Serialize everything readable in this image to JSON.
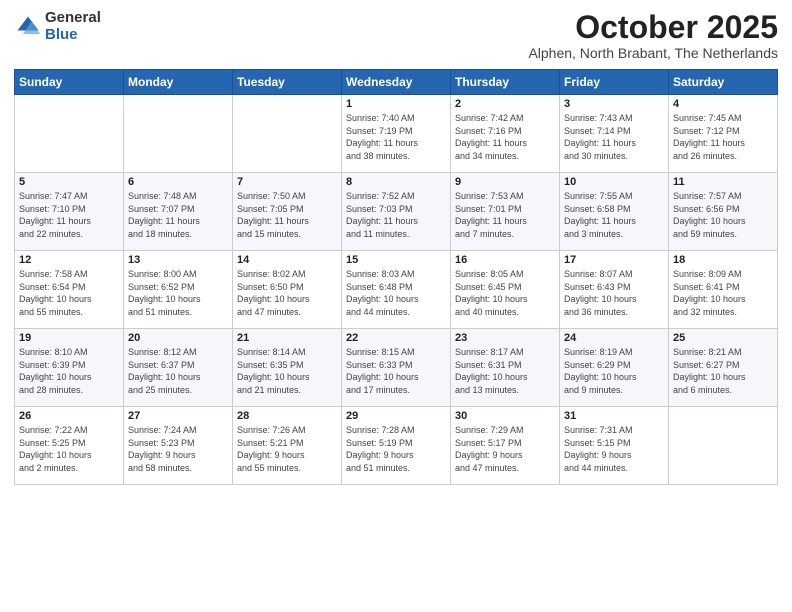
{
  "logo": {
    "general": "General",
    "blue": "Blue"
  },
  "header": {
    "month": "October 2025",
    "location": "Alphen, North Brabant, The Netherlands"
  },
  "weekdays": [
    "Sunday",
    "Monday",
    "Tuesday",
    "Wednesday",
    "Thursday",
    "Friday",
    "Saturday"
  ],
  "weeks": [
    [
      {
        "day": "",
        "info": ""
      },
      {
        "day": "",
        "info": ""
      },
      {
        "day": "",
        "info": ""
      },
      {
        "day": "1",
        "info": "Sunrise: 7:40 AM\nSunset: 7:19 PM\nDaylight: 11 hours\nand 38 minutes."
      },
      {
        "day": "2",
        "info": "Sunrise: 7:42 AM\nSunset: 7:16 PM\nDaylight: 11 hours\nand 34 minutes."
      },
      {
        "day": "3",
        "info": "Sunrise: 7:43 AM\nSunset: 7:14 PM\nDaylight: 11 hours\nand 30 minutes."
      },
      {
        "day": "4",
        "info": "Sunrise: 7:45 AM\nSunset: 7:12 PM\nDaylight: 11 hours\nand 26 minutes."
      }
    ],
    [
      {
        "day": "5",
        "info": "Sunrise: 7:47 AM\nSunset: 7:10 PM\nDaylight: 11 hours\nand 22 minutes."
      },
      {
        "day": "6",
        "info": "Sunrise: 7:48 AM\nSunset: 7:07 PM\nDaylight: 11 hours\nand 18 minutes."
      },
      {
        "day": "7",
        "info": "Sunrise: 7:50 AM\nSunset: 7:05 PM\nDaylight: 11 hours\nand 15 minutes."
      },
      {
        "day": "8",
        "info": "Sunrise: 7:52 AM\nSunset: 7:03 PM\nDaylight: 11 hours\nand 11 minutes."
      },
      {
        "day": "9",
        "info": "Sunrise: 7:53 AM\nSunset: 7:01 PM\nDaylight: 11 hours\nand 7 minutes."
      },
      {
        "day": "10",
        "info": "Sunrise: 7:55 AM\nSunset: 6:58 PM\nDaylight: 11 hours\nand 3 minutes."
      },
      {
        "day": "11",
        "info": "Sunrise: 7:57 AM\nSunset: 6:56 PM\nDaylight: 10 hours\nand 59 minutes."
      }
    ],
    [
      {
        "day": "12",
        "info": "Sunrise: 7:58 AM\nSunset: 6:54 PM\nDaylight: 10 hours\nand 55 minutes."
      },
      {
        "day": "13",
        "info": "Sunrise: 8:00 AM\nSunset: 6:52 PM\nDaylight: 10 hours\nand 51 minutes."
      },
      {
        "day": "14",
        "info": "Sunrise: 8:02 AM\nSunset: 6:50 PM\nDaylight: 10 hours\nand 47 minutes."
      },
      {
        "day": "15",
        "info": "Sunrise: 8:03 AM\nSunset: 6:48 PM\nDaylight: 10 hours\nand 44 minutes."
      },
      {
        "day": "16",
        "info": "Sunrise: 8:05 AM\nSunset: 6:45 PM\nDaylight: 10 hours\nand 40 minutes."
      },
      {
        "day": "17",
        "info": "Sunrise: 8:07 AM\nSunset: 6:43 PM\nDaylight: 10 hours\nand 36 minutes."
      },
      {
        "day": "18",
        "info": "Sunrise: 8:09 AM\nSunset: 6:41 PM\nDaylight: 10 hours\nand 32 minutes."
      }
    ],
    [
      {
        "day": "19",
        "info": "Sunrise: 8:10 AM\nSunset: 6:39 PM\nDaylight: 10 hours\nand 28 minutes."
      },
      {
        "day": "20",
        "info": "Sunrise: 8:12 AM\nSunset: 6:37 PM\nDaylight: 10 hours\nand 25 minutes."
      },
      {
        "day": "21",
        "info": "Sunrise: 8:14 AM\nSunset: 6:35 PM\nDaylight: 10 hours\nand 21 minutes."
      },
      {
        "day": "22",
        "info": "Sunrise: 8:15 AM\nSunset: 6:33 PM\nDaylight: 10 hours\nand 17 minutes."
      },
      {
        "day": "23",
        "info": "Sunrise: 8:17 AM\nSunset: 6:31 PM\nDaylight: 10 hours\nand 13 minutes."
      },
      {
        "day": "24",
        "info": "Sunrise: 8:19 AM\nSunset: 6:29 PM\nDaylight: 10 hours\nand 9 minutes."
      },
      {
        "day": "25",
        "info": "Sunrise: 8:21 AM\nSunset: 6:27 PM\nDaylight: 10 hours\nand 6 minutes."
      }
    ],
    [
      {
        "day": "26",
        "info": "Sunrise: 7:22 AM\nSunset: 5:25 PM\nDaylight: 10 hours\nand 2 minutes."
      },
      {
        "day": "27",
        "info": "Sunrise: 7:24 AM\nSunset: 5:23 PM\nDaylight: 9 hours\nand 58 minutes."
      },
      {
        "day": "28",
        "info": "Sunrise: 7:26 AM\nSunset: 5:21 PM\nDaylight: 9 hours\nand 55 minutes."
      },
      {
        "day": "29",
        "info": "Sunrise: 7:28 AM\nSunset: 5:19 PM\nDaylight: 9 hours\nand 51 minutes."
      },
      {
        "day": "30",
        "info": "Sunrise: 7:29 AM\nSunset: 5:17 PM\nDaylight: 9 hours\nand 47 minutes."
      },
      {
        "day": "31",
        "info": "Sunrise: 7:31 AM\nSunset: 5:15 PM\nDaylight: 9 hours\nand 44 minutes."
      },
      {
        "day": "",
        "info": ""
      }
    ]
  ]
}
